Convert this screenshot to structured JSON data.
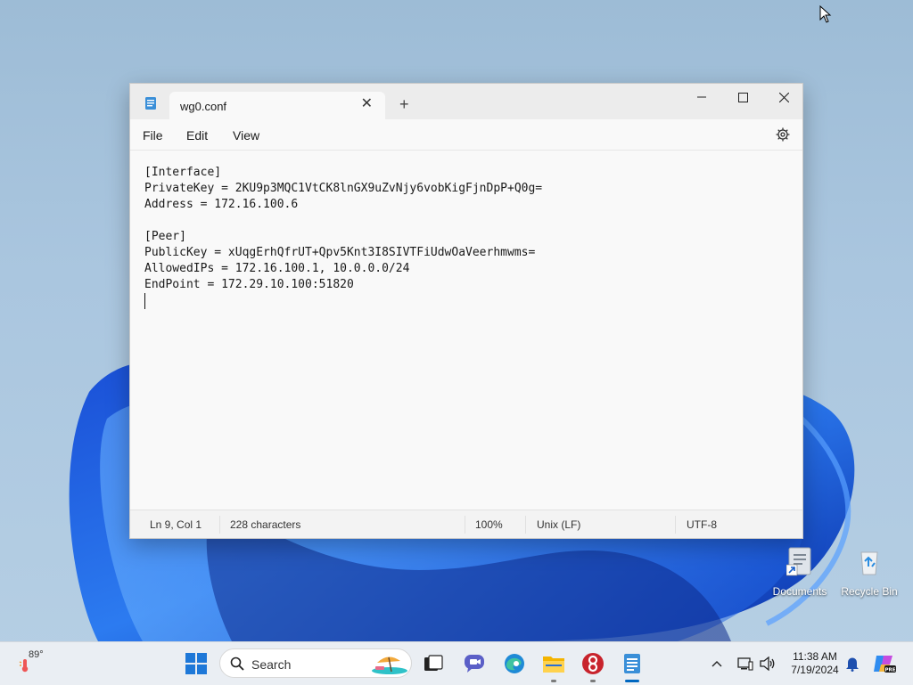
{
  "window": {
    "tab_title": "wg0.conf",
    "tab_close": "✕",
    "new_tab": "+",
    "menu": [
      "File",
      "Edit",
      "View"
    ]
  },
  "editor": {
    "lines": [
      "[Interface]",
      "PrivateKey = 2KU9p3MQC1VtCK8lnGX9uZvNjy6vobKigFjnDpP+Q0g=",
      "Address = 172.16.100.6",
      "",
      "[Peer]",
      "PublicKey = xUqgErhQfrUT+Qpv5Knt3I8SIVTFiUdwOaVeerhmwms=",
      "AllowedIPs = 172.16.100.1, 10.0.0.0/24",
      "EndPoint = 172.29.10.100:51820"
    ]
  },
  "status": {
    "position": "Ln 9, Col 1",
    "characters": "228 characters",
    "zoom": "100%",
    "line_ending": "Unix (LF)",
    "encoding": "UTF-8"
  },
  "desktop": {
    "icons": [
      {
        "label": "Documents",
        "icon": "documents-shortcut-icon"
      },
      {
        "label": "Recycle Bin",
        "icon": "recycle-bin-icon"
      }
    ]
  },
  "taskbar": {
    "weather_temp": "89°",
    "search_placeholder": "Search",
    "clock_time": "11:38 AM",
    "clock_date": "7/19/2024",
    "colors": {
      "accent": "#0067c0",
      "start_blue": "#1e78d8"
    }
  }
}
